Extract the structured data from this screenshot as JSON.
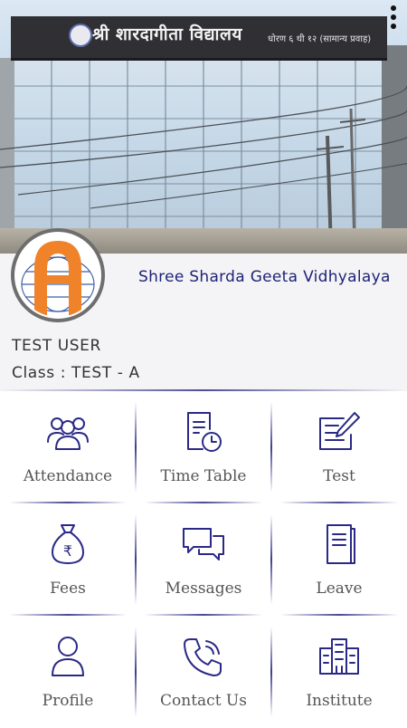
{
  "header": {
    "photo_sign_text": "श्री शारदागीता विद्यालय",
    "photo_sign_subtext": "धोरण ६ थी १२ (सामान्य प्रवाह)"
  },
  "school": {
    "name": "Shree Sharda Geeta Vidhyalaya"
  },
  "user": {
    "name": "TEST USER",
    "class_line": "Class : TEST - A"
  },
  "menu": [
    {
      "label": "Attendance",
      "icon": "people-group-icon"
    },
    {
      "label": "Time Table",
      "icon": "timetable-clock-icon"
    },
    {
      "label": "Test",
      "icon": "edit-note-icon"
    },
    {
      "label": "Fees",
      "icon": "money-bag-icon"
    },
    {
      "label": "Messages",
      "icon": "chat-bubbles-icon"
    },
    {
      "label": "Leave",
      "icon": "document-icon"
    },
    {
      "label": "Profile",
      "icon": "person-icon"
    },
    {
      "label": "Contact Us",
      "icon": "phone-icon"
    },
    {
      "label": "Institute",
      "icon": "building-icon"
    }
  ],
  "colors": {
    "accent": "#2a2a86",
    "school_name": "#1e2377",
    "logo_orange": "#f0832a"
  }
}
